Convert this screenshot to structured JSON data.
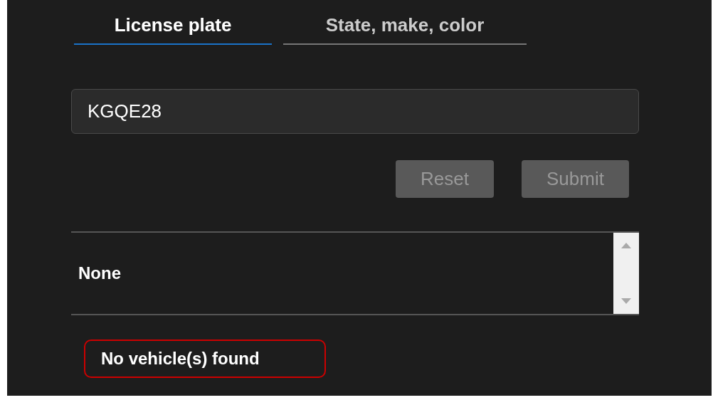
{
  "tabs": [
    {
      "label": "License plate",
      "selected": true
    },
    {
      "label": "State, make, color",
      "selected": false
    }
  ],
  "plate_field": {
    "value": "KGQE28"
  },
  "buttons": [
    {
      "label": "Reset",
      "disabled": true
    },
    {
      "label": "Submit",
      "disabled": true
    }
  ],
  "results": {
    "items": [
      "None"
    ]
  },
  "message": {
    "text": "No vehicle(s) found",
    "kind": "error"
  }
}
